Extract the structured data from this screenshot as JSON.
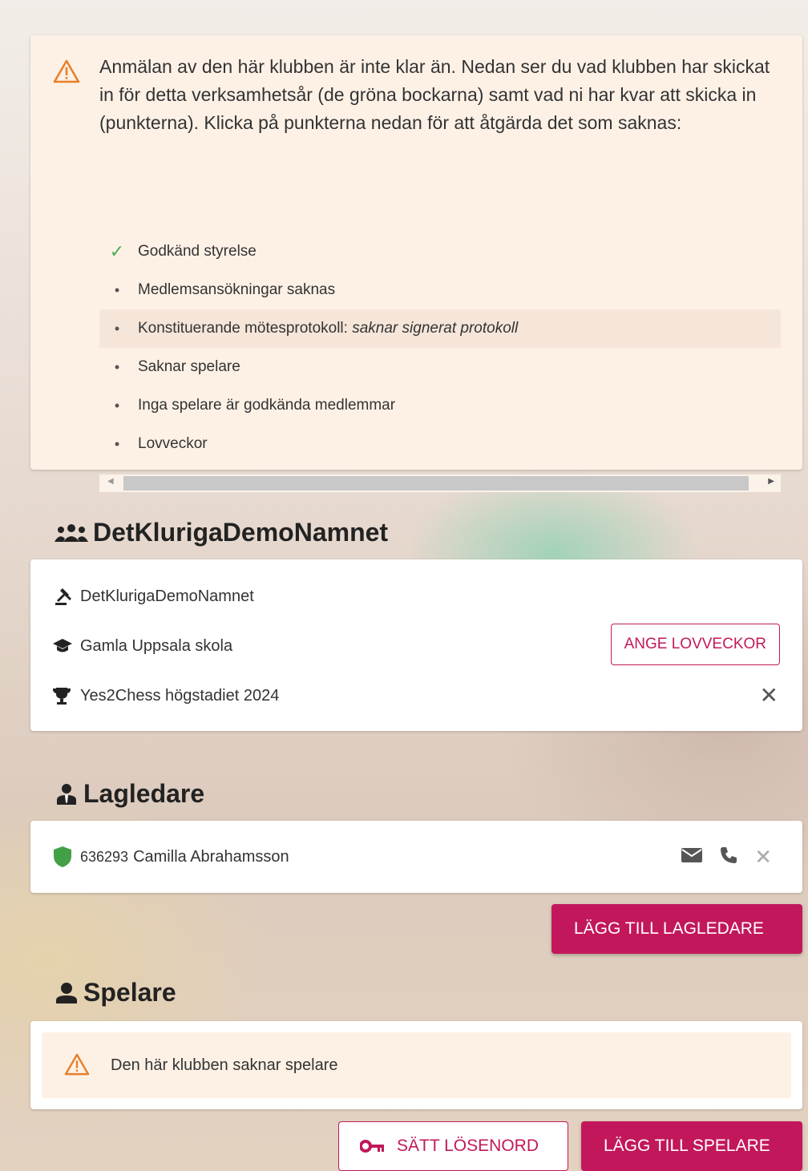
{
  "alert": {
    "icon": "warning-icon",
    "message": "Anmälan av den här klubben är inte klar än. Nedan ser du vad klubben har skickat in för detta verksamhetsår (de gröna bockarna) samt vad ni har kvar att skicka in (punkterna). Klicka på punkterna nedan för att åtgärda det som saknas:",
    "items": [
      {
        "label": "Godkänd styrelse",
        "done": true
      },
      {
        "label": "Medlemsansökningar saknas",
        "done": false
      },
      {
        "label": "Konstituerande mötesprotokoll:",
        "note": "saknar signerat protokoll",
        "done": false,
        "highlighted": true
      },
      {
        "label": "Saknar spelare",
        "done": false
      },
      {
        "label": "Inga spelare är godkända medlemmar",
        "done": false
      },
      {
        "label": "Lovveckor",
        "done": false
      }
    ],
    "bullet": "•",
    "check": "✓"
  },
  "club": {
    "title": "DetKlurigaDemoNamnet",
    "title_icon": "group-icon",
    "rows": [
      {
        "icon": "gavel-icon",
        "text": "DetKlurigaDemoNamnet"
      },
      {
        "icon": "school-icon",
        "text": "Gamla Uppsala skola"
      },
      {
        "icon": "trophy-icon",
        "text": "Yes2Chess högstadiet 2024"
      }
    ],
    "set_holidays_button": "ANGE LOVVECKOR",
    "remove_symbol": "✕"
  },
  "leaders": {
    "title": "Lagledare",
    "title_icon": "leader-icon",
    "people": [
      {
        "id": "636293",
        "name": "Camilla Abrahamsson",
        "status_icon": "shield-icon",
        "status_color": "#43a047"
      }
    ],
    "remove_symbol": "✕",
    "add_button": "LÄGG TILL LAGLEDARE"
  },
  "players": {
    "title": "Spelare",
    "title_icon": "person-icon",
    "empty_message": "Den här klubben saknar spelare",
    "set_password_button": "SÄTT LÖSENORD",
    "add_button": "LÄGG TILL SPELARE"
  },
  "colors": {
    "accent": "#c2185b",
    "warning": "#e8802a",
    "success": "#4caf50",
    "alert_bg": "#fdf1e6"
  }
}
